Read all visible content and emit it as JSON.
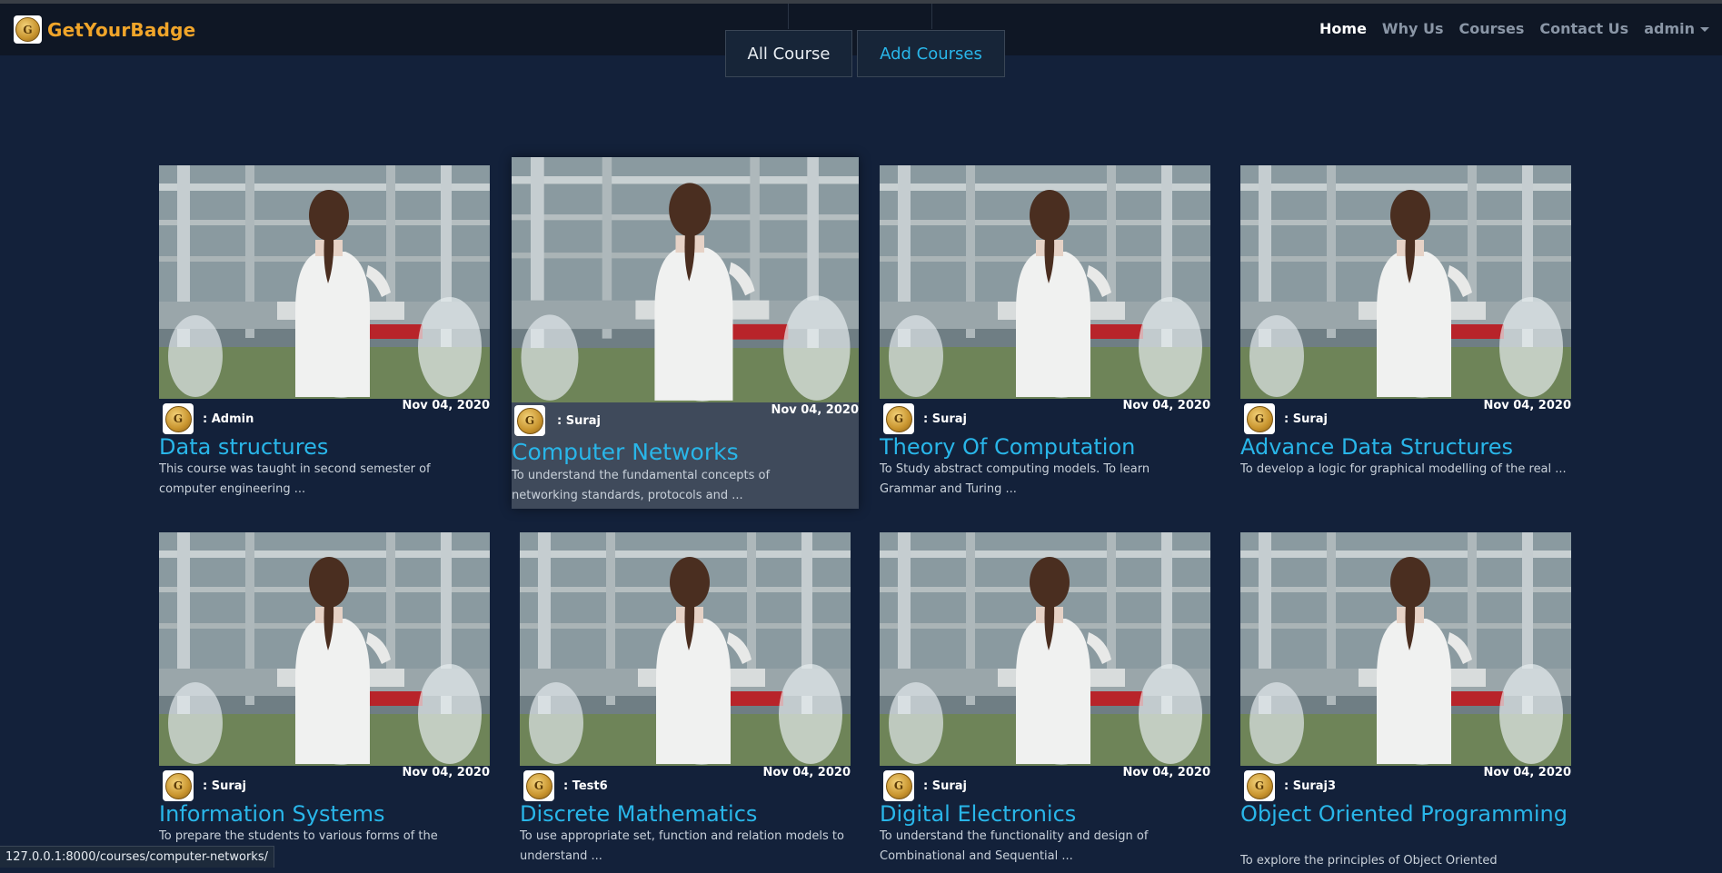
{
  "brand": {
    "name": "GetYourBadge",
    "logo_letter": "G"
  },
  "nav": {
    "home": "Home",
    "why_us": "Why Us",
    "courses": "Courses",
    "contact": "Contact Us",
    "user": "admin"
  },
  "tabs": {
    "all": "All Course",
    "add": "Add Courses"
  },
  "courses": [
    {
      "author": ": Admin",
      "date": "Nov 04, 2020",
      "title": "Data structures",
      "desc": "This course was taught in second semester of computer engineering ..."
    },
    {
      "author": ": Suraj",
      "date": "Nov 04, 2020",
      "title": "Computer Networks",
      "desc": "To understand the fundamental concepts of networking standards, protocols and ..."
    },
    {
      "author": ": Suraj",
      "date": "Nov 04, 2020",
      "title": "Theory Of Computation",
      "desc": "To Study abstract computing models. To learn Grammar and Turing ..."
    },
    {
      "author": ": Suraj",
      "date": "Nov 04, 2020",
      "title": "Advance Data Structures",
      "desc": "To develop a logic for graphical modelling of the real ..."
    },
    {
      "author": ": Suraj",
      "date": "Nov 04, 2020",
      "title": "Information Systems",
      "desc": "To prepare the students to various forms of the"
    },
    {
      "author": ": Test6",
      "date": "Nov 04, 2020",
      "title": "Discrete Mathematics",
      "desc": "To use appropriate set, function and relation models to understand ..."
    },
    {
      "author": ": Suraj",
      "date": "Nov 04, 2020",
      "title": "Digital Electronics",
      "desc": "To understand the functionality and design of Combinational and Sequential ..."
    },
    {
      "author": ": Suraj3",
      "date": "Nov 04, 2020",
      "title": "Object Oriented Programming",
      "desc": "To explore the principles of Object Oriented"
    }
  ],
  "status_bar": {
    "url": "127.0.0.1:8000/courses/computer-networks/"
  },
  "colors": {
    "accent": "#29b6e9",
    "brand": "#f0a52a",
    "background": "#13213a"
  }
}
